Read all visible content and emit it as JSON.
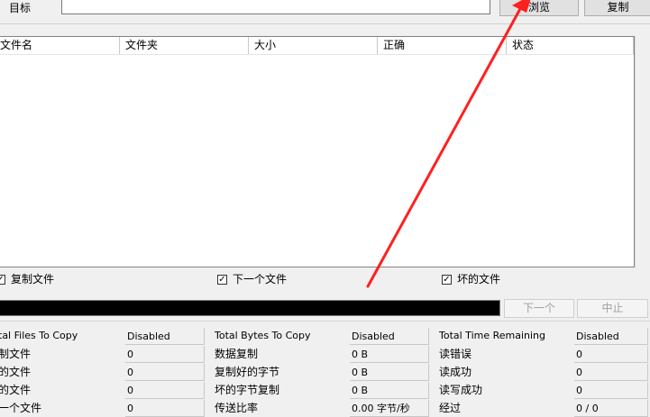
{
  "target": {
    "label": "目标",
    "value": ""
  },
  "buttons": {
    "browse": "浏览",
    "copy": "复制",
    "next": "下一个",
    "stop": "中止"
  },
  "file_list": {
    "columns": [
      "文件名",
      "文件夹",
      "大小",
      "正确",
      "状态"
    ],
    "rows": []
  },
  "checkboxes": [
    {
      "label": "复制文件",
      "checked": true
    },
    {
      "label": "下一个文件",
      "checked": true
    },
    {
      "label": "坏的文件",
      "checked": true
    }
  ],
  "progress": {
    "fraction": 0
  },
  "stats": {
    "col1": {
      "rows": [
        {
          "label": "tal Files To Copy",
          "value": "Disabled"
        },
        {
          "label": "制文件",
          "value": "0"
        },
        {
          "label": "的文件",
          "value": "0"
        },
        {
          "label": "的文件",
          "value": "0"
        },
        {
          "label": "一个文件",
          "value": "0"
        }
      ]
    },
    "col2": {
      "rows": [
        {
          "label": "Total Bytes To Copy",
          "value": "Disabled"
        },
        {
          "label": "数据复制",
          "value": "0 B"
        },
        {
          "label": "复制好的字节",
          "value": "0 B"
        },
        {
          "label": "坏的字节复制",
          "value": "0 B"
        },
        {
          "label": "传送比率",
          "value": "0.00 字节/秒"
        }
      ]
    },
    "col3": {
      "rows": [
        {
          "label": "Total Time Remaining",
          "value": "Disabled"
        },
        {
          "label": "读错误",
          "value": "0"
        },
        {
          "label": "读成功",
          "value": "0"
        },
        {
          "label": "读写成功",
          "value": "0"
        },
        {
          "label": "经过",
          "value": "0 / 0"
        }
      ]
    }
  },
  "colors": {
    "arrow": "#ff2020",
    "progress_bg": "#000000"
  }
}
